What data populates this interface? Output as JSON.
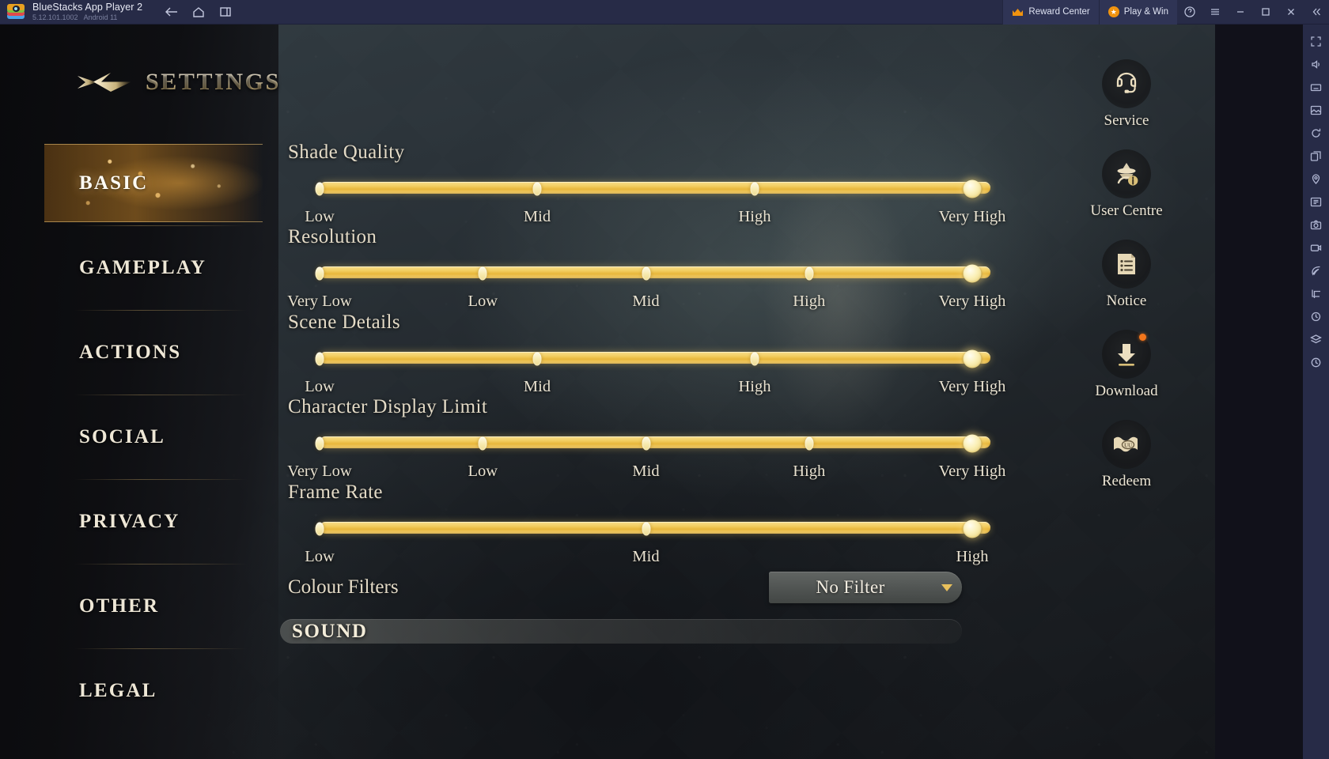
{
  "titlebar": {
    "app_name": "BlueStacks App Player 2",
    "version": "5.12.101.1002",
    "android_version": "Android 11",
    "nav": [
      {
        "name": "back",
        "label": "Back"
      },
      {
        "name": "home",
        "label": "Home"
      },
      {
        "name": "recents",
        "label": "Recent apps"
      }
    ],
    "reward_center": "Reward Center",
    "play_and_win": "Play & Win",
    "help_label": "Help",
    "menu_label": "Menu",
    "minimize_label": "Minimize",
    "maximize_label": "Maximize",
    "close_label": "Close",
    "collapse_label": "Collapse"
  },
  "bluestacks_rail": [
    "fullscreen-icon",
    "volume-icon",
    "keyboard-icon",
    "gallery-icon",
    "rotate-icon",
    "location-icon",
    "multi-instance-icon",
    "macro-icon",
    "screenshot-icon",
    "record-icon",
    "eco-mode-icon",
    "trim-icon",
    "shake-icon",
    "layers-icon",
    "history-icon"
  ],
  "header": {
    "title": "SETTINGS",
    "back_icon": "back-arrow-icon"
  },
  "sidebar": {
    "items": [
      {
        "label": "BASIC",
        "active": true
      },
      {
        "label": "GAMEPLAY",
        "active": false
      },
      {
        "label": "ACTIONS",
        "active": false
      },
      {
        "label": "SOCIAL",
        "active": false
      },
      {
        "label": "PRIVACY",
        "active": false
      },
      {
        "label": "OTHER",
        "active": false
      },
      {
        "label": "LEGAL",
        "active": false
      }
    ]
  },
  "settings": {
    "sliders": [
      {
        "label": "Shade Quality",
        "ticks": [
          "Low",
          "Mid",
          "High",
          "Very High"
        ],
        "value_index": 3,
        "value": "Very High"
      },
      {
        "label": "Resolution",
        "ticks": [
          "Very Low",
          "Low",
          "Mid",
          "High",
          "Very High"
        ],
        "value_index": 4,
        "value": "Very High"
      },
      {
        "label": "Scene Details",
        "ticks": [
          "Low",
          "Mid",
          "High",
          "Very High"
        ],
        "value_index": 3,
        "value": "Very High"
      },
      {
        "label": "Character Display Limit",
        "ticks": [
          "Very Low",
          "Low",
          "Mid",
          "High",
          "Very High"
        ],
        "value_index": 4,
        "value": "Very High"
      },
      {
        "label": "Frame Rate",
        "ticks": [
          "Low",
          "Mid",
          "High"
        ],
        "value_index": 2,
        "value": "High"
      }
    ],
    "colour_filters": {
      "label": "Colour Filters",
      "value": "No Filter"
    },
    "sound_section": {
      "title": "SOUND"
    }
  },
  "game_rail": [
    {
      "label": "Service",
      "icon": "headset-icon",
      "badge": false
    },
    {
      "label": "User Centre",
      "icon": "avatar-icon",
      "badge": false
    },
    {
      "label": "Notice",
      "icon": "notice-icon",
      "badge": false
    },
    {
      "label": "Download",
      "icon": "download-icon",
      "badge": true
    },
    {
      "label": "Redeem",
      "icon": "ticket-icon",
      "badge": false
    }
  ],
  "colors": {
    "titlebar_bg": "#272b47",
    "accent_gold": "#f3cf63",
    "panel_dark": "#0c0c0f",
    "text_cream": "#e9e2d0",
    "badge_orange": "#f4761c"
  }
}
